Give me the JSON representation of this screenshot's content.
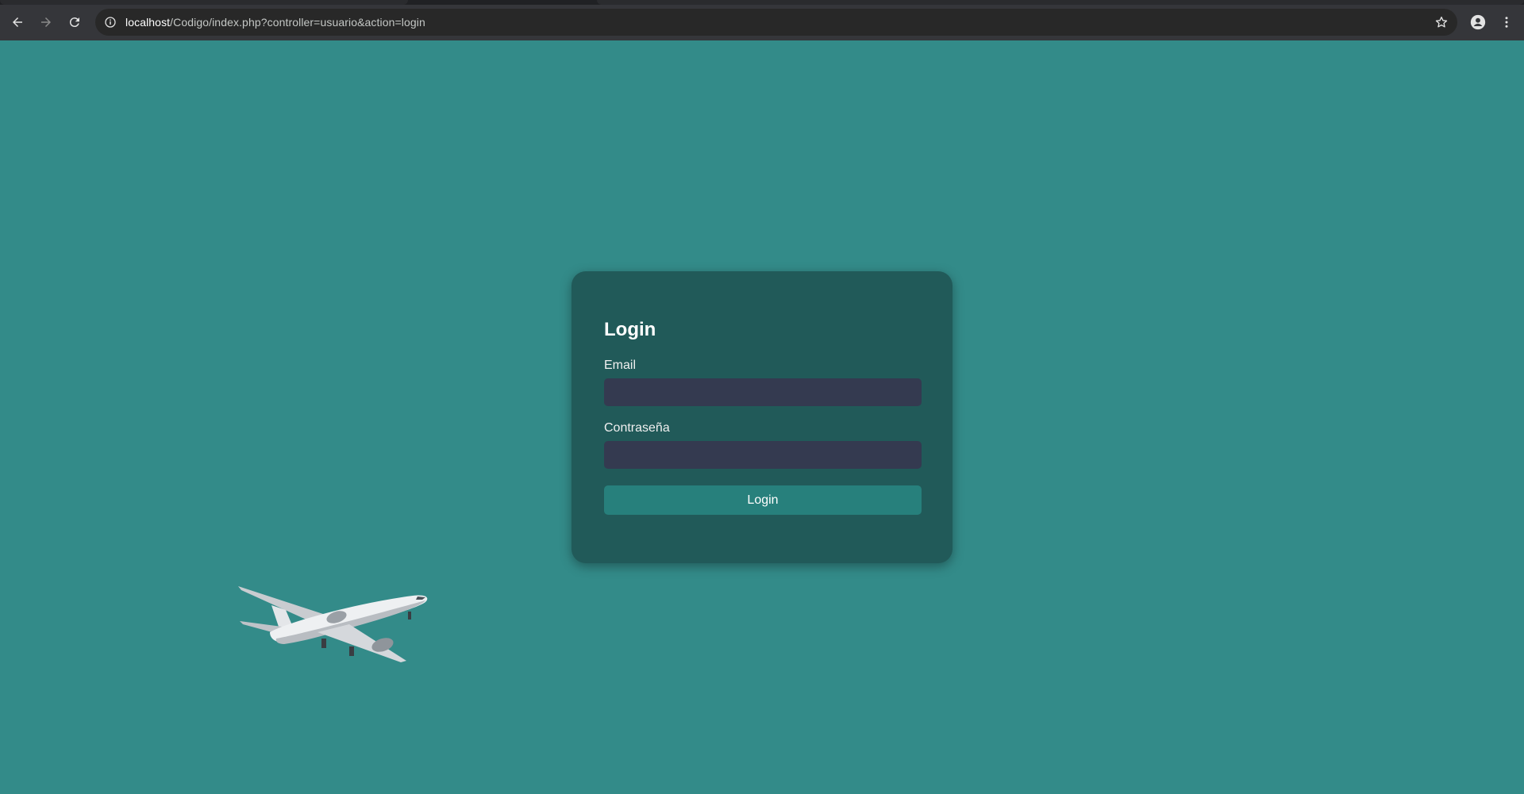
{
  "browser": {
    "url_host": "localhost",
    "url_path": "/Codigo/index.php?controller=usuario&action=login",
    "icons": {
      "back": "back-arrow-icon",
      "forward": "forward-arrow-icon",
      "reload": "reload-icon",
      "site_info": "info-icon",
      "bookmark": "star-icon",
      "profile": "profile-icon",
      "menu": "more-vert-icon"
    }
  },
  "colors": {
    "page_background": "#338b89",
    "card_background": "#215a59",
    "input_background": "#343a50",
    "button_background": "#27807c"
  },
  "login": {
    "title": "Login",
    "email_label": "Email",
    "email_value": "",
    "password_label": "Contraseña",
    "password_value": "",
    "submit_label": "Login"
  },
  "decoration": {
    "image": "airplane"
  }
}
